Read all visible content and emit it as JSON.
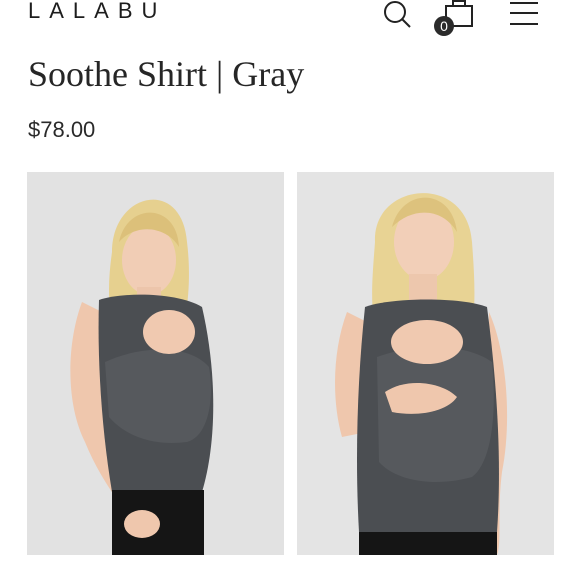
{
  "header": {
    "logo": "LALABU",
    "cart_count": "0",
    "icons": [
      "search-icon",
      "shopping-bag-icon",
      "menu-icon"
    ]
  },
  "product": {
    "title": "Soothe Shirt | Gray",
    "price": "$78.00",
    "images": [
      {
        "name": "product-photo-front-baby-asleep"
      },
      {
        "name": "product-photo-front-smiling"
      }
    ]
  },
  "colors": {
    "text": "#222222",
    "shirt": "#4a4d50",
    "background": "#e3e3e3"
  }
}
